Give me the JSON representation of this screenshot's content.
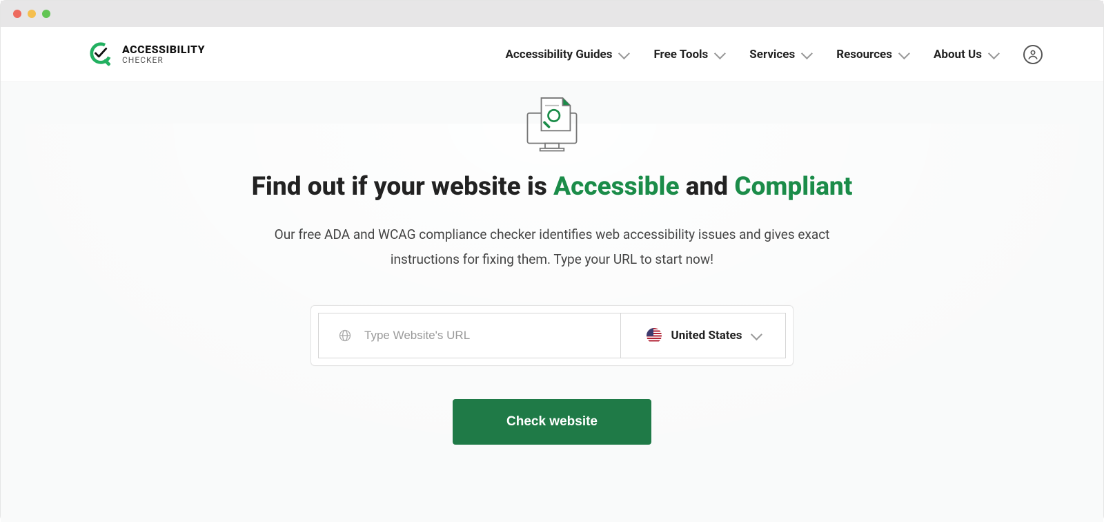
{
  "brand": {
    "top": "ACCESSIBILITY",
    "bottom": "CHECKER"
  },
  "nav": {
    "items": [
      {
        "label": "Accessibility Guides"
      },
      {
        "label": "Free Tools"
      },
      {
        "label": "Services"
      },
      {
        "label": "Resources"
      },
      {
        "label": "About Us"
      }
    ]
  },
  "hero": {
    "headline_prefix": "Find out if your website is ",
    "headline_accent1": "Accessible",
    "headline_mid": " and ",
    "headline_accent2": "Compliant",
    "subtitle": "Our free ADA and WCAG compliance checker identifies web accessibility issues and gives exact instructions for fixing them. Type your URL to start now!"
  },
  "form": {
    "url_placeholder": "Type Website's URL",
    "country_selected": "United States",
    "cta_label": "Check website"
  },
  "colors": {
    "accent": "#1b8c49",
    "cta_bg": "#1f7a47"
  }
}
